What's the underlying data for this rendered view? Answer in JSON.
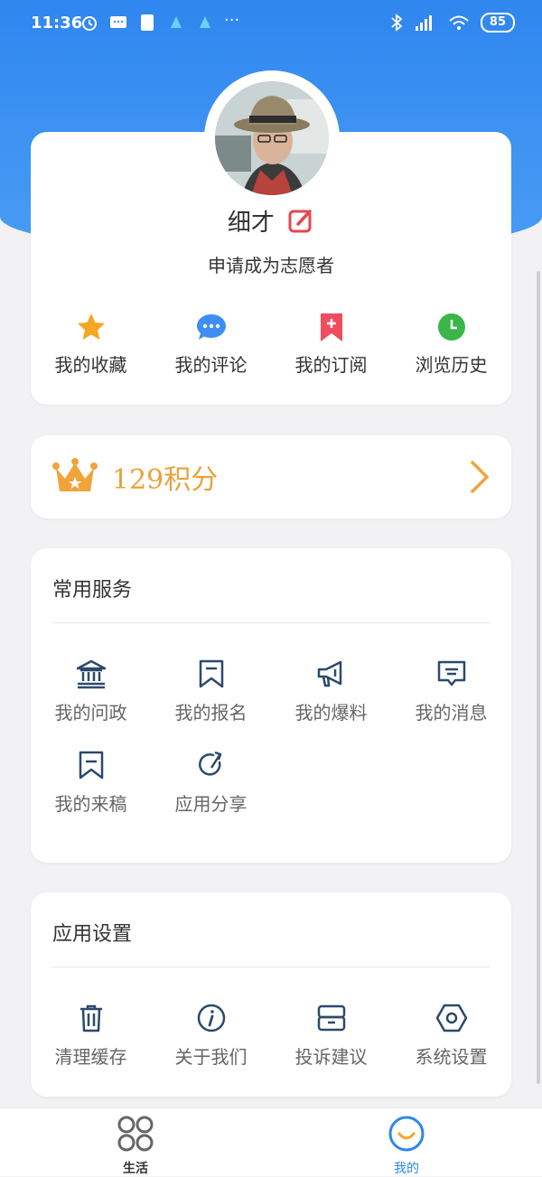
{
  "status_bar": {
    "time": "11:36",
    "battery": "85"
  },
  "profile": {
    "username": "细才",
    "volunteer_link": "申请成为志愿者"
  },
  "quick_actions": [
    {
      "label": "我的收藏",
      "icon": "star-icon",
      "color": "#f5a623"
    },
    {
      "label": "我的评论",
      "icon": "comment-icon",
      "color": "#3d8df5"
    },
    {
      "label": "我的订阅",
      "icon": "bookmark-plus-icon",
      "color": "#ee4d5f"
    },
    {
      "label": "浏览历史",
      "icon": "clock-icon",
      "color": "#3bb54a"
    }
  ],
  "points": {
    "text": "129积分",
    "color": "#e9a23b"
  },
  "services": {
    "title": "常用服务",
    "items": [
      {
        "label": "我的问政",
        "icon": "government-building-icon"
      },
      {
        "label": "我的报名",
        "icon": "ribbon-icon"
      },
      {
        "label": "我的爆料",
        "icon": "megaphone-icon"
      },
      {
        "label": "我的消息",
        "icon": "message-icon"
      },
      {
        "label": "我的来稿",
        "icon": "manuscript-icon"
      },
      {
        "label": "应用分享",
        "icon": "share-icon"
      }
    ]
  },
  "settings": {
    "title": "应用设置",
    "items": [
      {
        "label": "清理缓存",
        "icon": "trash-icon"
      },
      {
        "label": "关于我们",
        "icon": "info-icon"
      },
      {
        "label": "投诉建议",
        "icon": "feedback-icon"
      },
      {
        "label": "系统设置",
        "icon": "settings-hex-icon"
      }
    ]
  },
  "tabbar": {
    "tabs": [
      {
        "label": "生活",
        "icon": "grid-circles-icon"
      },
      {
        "label": "我的",
        "icon": "smile-circle-icon",
        "active": true
      }
    ],
    "active_color": "#2f86ee"
  },
  "colors": {
    "brand_blue": "#2f86ee",
    "icon_stroke": "#2b4a6b"
  }
}
